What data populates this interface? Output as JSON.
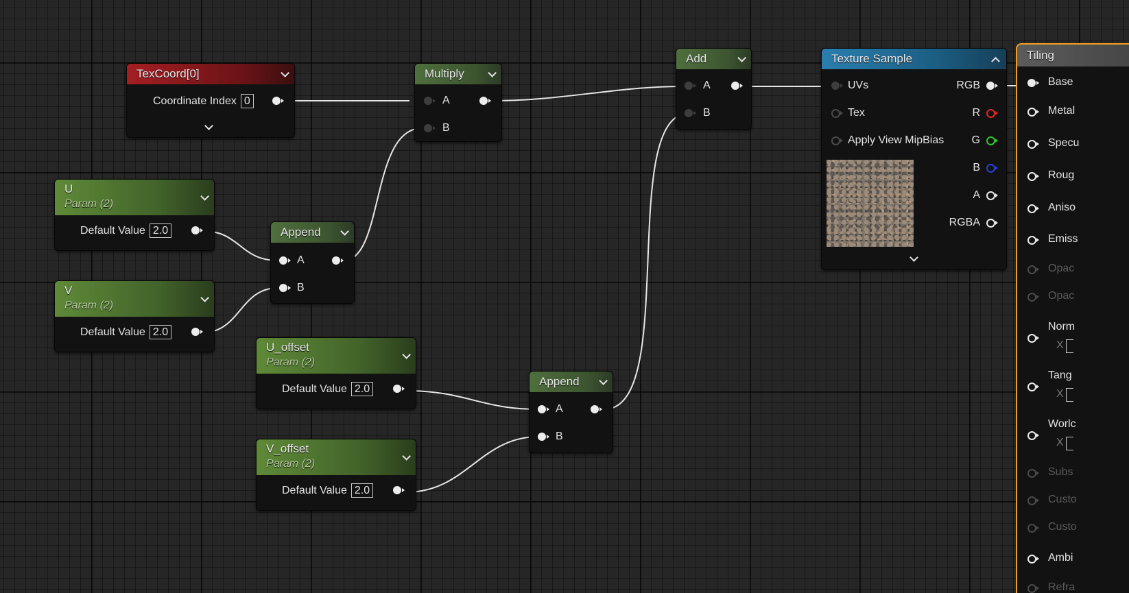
{
  "nodes": {
    "texcoord": {
      "title": "TexCoord[0]",
      "row_label": "Coordinate Index",
      "row_value": "0"
    },
    "u": {
      "title": "U",
      "subtitle": "Param (2)",
      "row_label": "Default Value",
      "row_value": "2.0"
    },
    "v": {
      "title": "V",
      "subtitle": "Param (2)",
      "row_label": "Default Value",
      "row_value": "2.0"
    },
    "u_offset": {
      "title": "U_offset",
      "subtitle": "Param (2)",
      "row_label": "Default Value",
      "row_value": "2.0"
    },
    "v_offset": {
      "title": "V_offset",
      "subtitle": "Param (2)",
      "row_label": "Default Value",
      "row_value": "2.0"
    },
    "append1": {
      "title": "Append",
      "pin_a": "A",
      "pin_b": "B"
    },
    "append2": {
      "title": "Append",
      "pin_a": "A",
      "pin_b": "B"
    },
    "multiply": {
      "title": "Multiply",
      "pin_a": "A",
      "pin_b": "B"
    },
    "add": {
      "title": "Add",
      "pin_a": "A",
      "pin_b": "B"
    },
    "texture_sample": {
      "title": "Texture Sample",
      "inputs": [
        "UVs",
        "Tex",
        "Apply View MipBias"
      ],
      "outputs": [
        "RGB",
        "R",
        "G",
        "B",
        "A",
        "RGBA"
      ]
    },
    "tiling": {
      "title": "Tiling",
      "pins": [
        "Base",
        "Metal",
        "Specu",
        "Roug",
        "Aniso",
        "Emiss",
        "Opac",
        "Opac",
        "Norm",
        "Tang",
        "Worlc",
        "Subs",
        "Custo",
        "Custo",
        "Ambi",
        "Refra"
      ],
      "x_label": "X"
    }
  },
  "colors": {
    "background": "#262626",
    "texcoord_header": "#a41e22",
    "param_header": "#5f8a38",
    "math_header": "#4f6f3d",
    "texture_header": "#2a7eae",
    "tiling_border": "#f0a020",
    "wire": "#e6e6e6"
  }
}
